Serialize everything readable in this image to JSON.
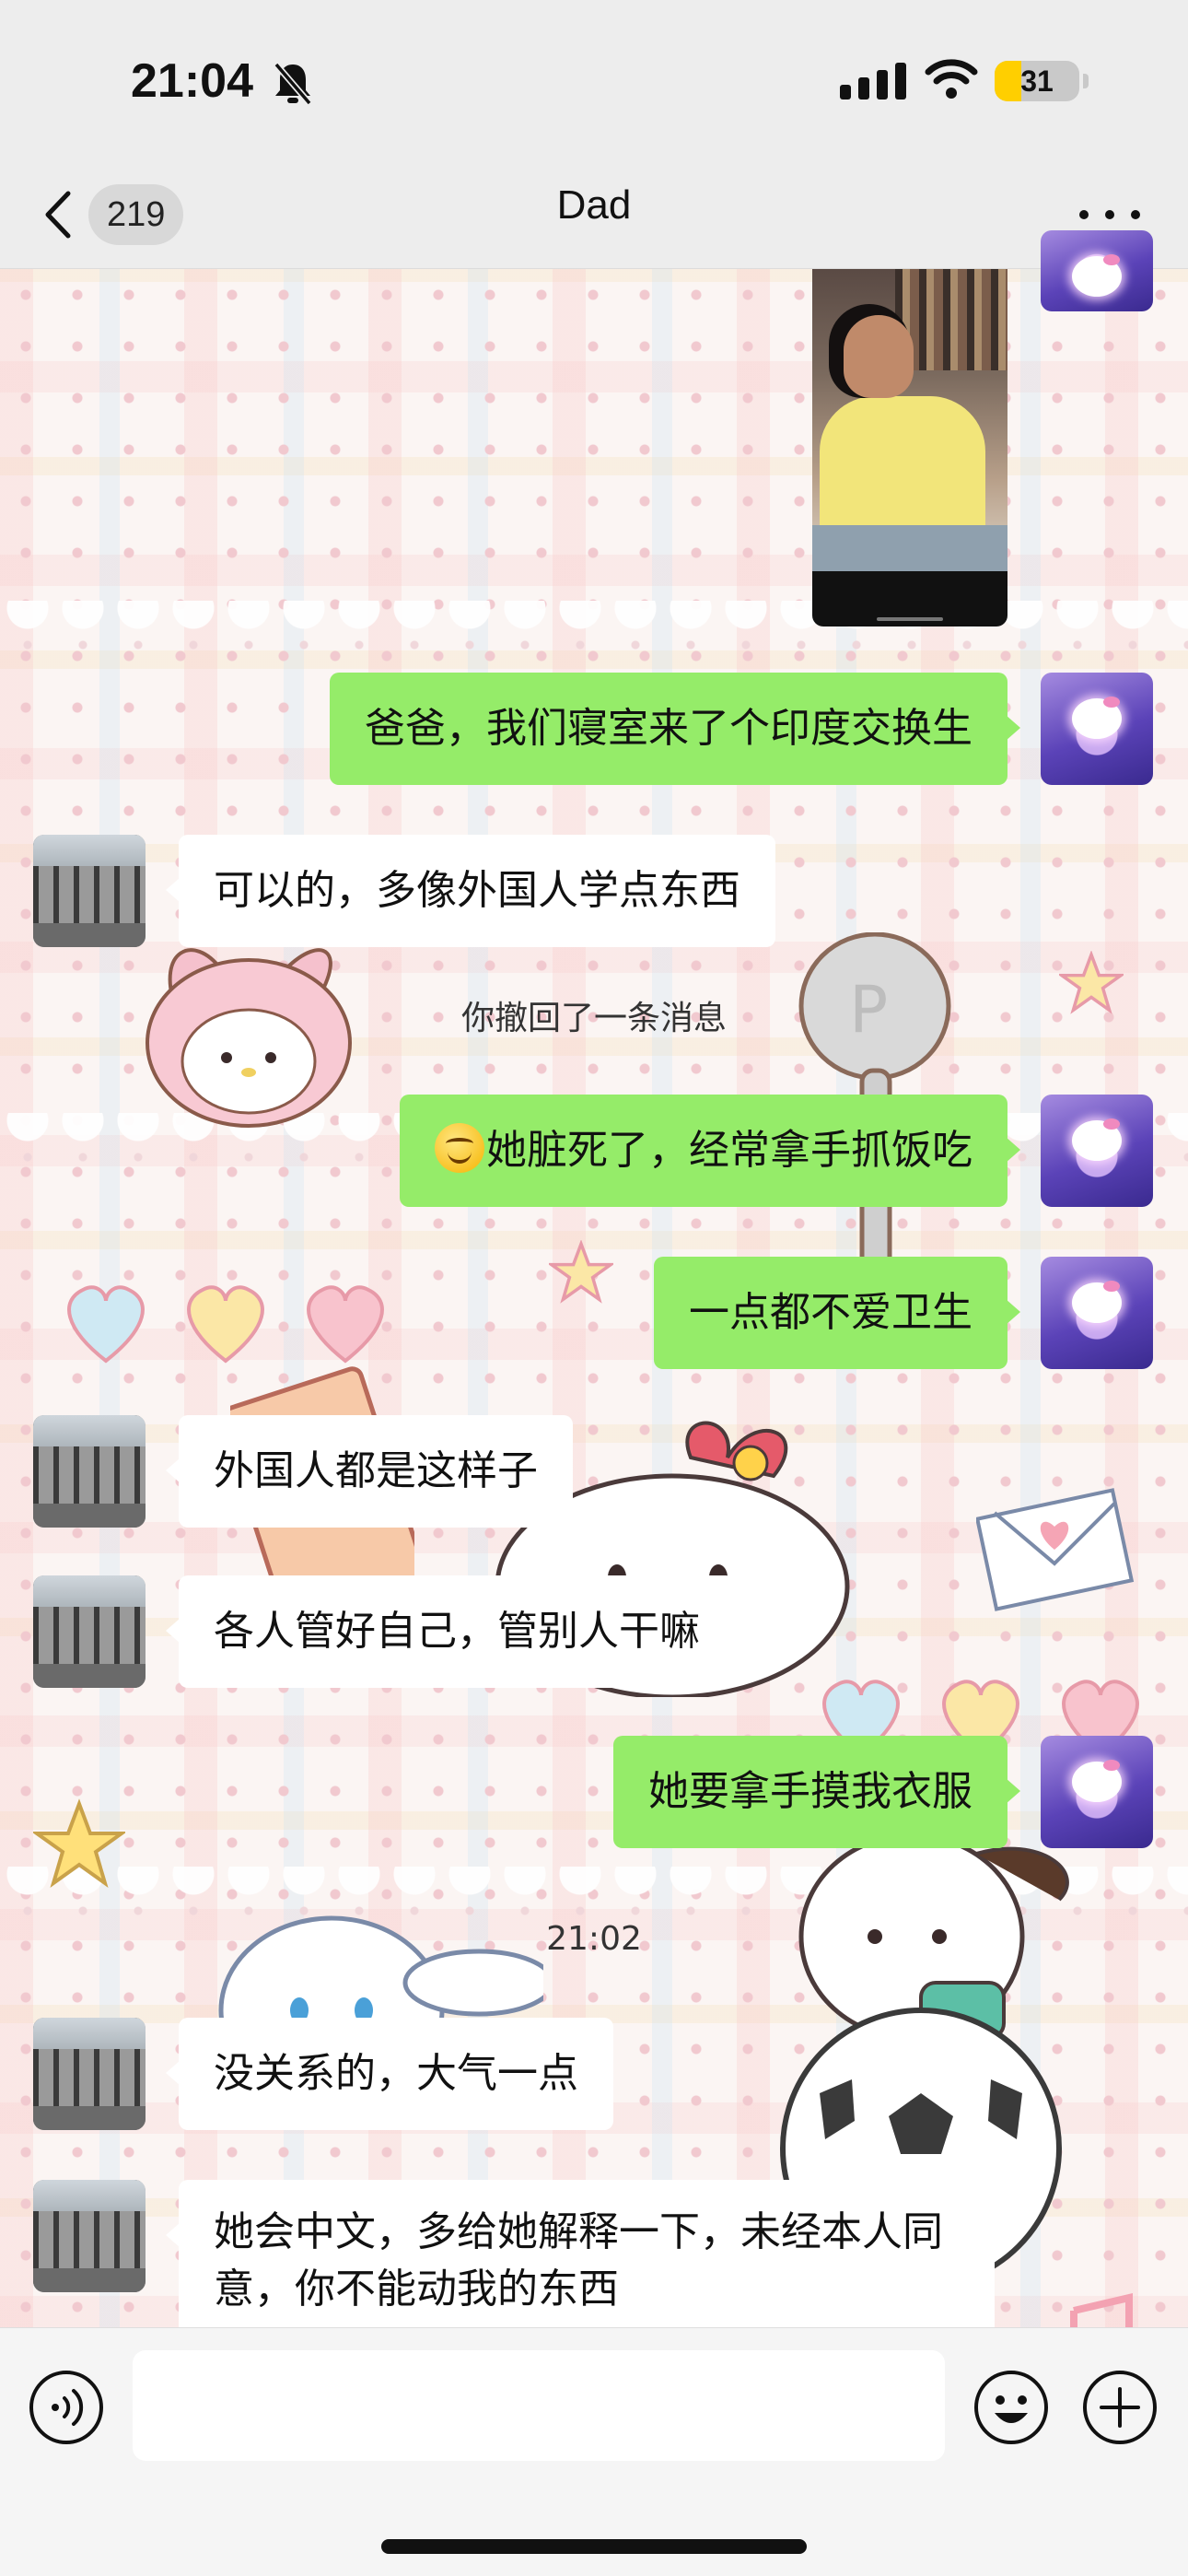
{
  "status_bar": {
    "time": "21:04",
    "battery_level": "31",
    "battery_fraction": 0.31,
    "accent_color": "#ffcf00"
  },
  "nav": {
    "unread_count": "219",
    "title": "Dad",
    "back_icon": "chevron-left-icon",
    "more_icon": "ellipsis-icon"
  },
  "messages": [
    {
      "from": "self",
      "type": "image"
    },
    {
      "from": "self",
      "type": "text",
      "text": "爸爸，我们寝室来了个印度交换生"
    },
    {
      "from": "dad",
      "type": "text",
      "text": "可以的，多像外国人学点东西"
    },
    {
      "type": "system",
      "text": "你撤回了一条消息"
    },
    {
      "from": "self",
      "type": "text",
      "emoji": "smiling-face-icon",
      "text": "她脏死了，经常拿手抓饭吃"
    },
    {
      "from": "self",
      "type": "text",
      "text": "一点都不爱卫生"
    },
    {
      "from": "dad",
      "type": "text",
      "text": "外国人都是这样子"
    },
    {
      "from": "dad",
      "type": "text",
      "text": "各人管好自己，管别人干嘛"
    },
    {
      "from": "self",
      "type": "text",
      "text": "她要拿手摸我衣服"
    },
    {
      "type": "time",
      "text": "21:02"
    },
    {
      "from": "dad",
      "type": "text",
      "text": "没关系的，大气一点"
    },
    {
      "from": "dad",
      "type": "text",
      "text": "她会中文，多给她解释一下，未经本人同意，你不能动我的东西"
    }
  ],
  "input_bar": {
    "value": "",
    "voice_icon": "voice-icon",
    "emoji_icon": "emoji-icon",
    "plus_icon": "plus-circle-icon"
  },
  "colors": {
    "outgoing_bubble": "#95ec69",
    "incoming_bubble": "#ffffff",
    "header_background": "#ededed"
  }
}
